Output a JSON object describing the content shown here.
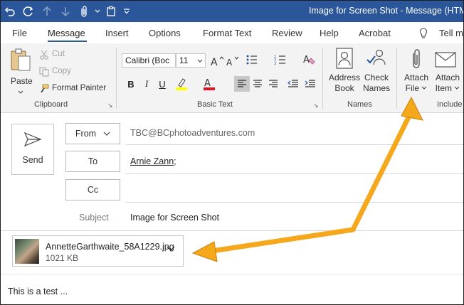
{
  "window": {
    "title": "Image for Screen Shot - Message (HTML)"
  },
  "tabs": [
    {
      "label": "File"
    },
    {
      "label": "Message"
    },
    {
      "label": "Insert"
    },
    {
      "label": "Options"
    },
    {
      "label": "Format Text"
    },
    {
      "label": "Review"
    },
    {
      "label": "Help"
    },
    {
      "label": "Acrobat"
    },
    {
      "label": "Tell m"
    }
  ],
  "ribbon": {
    "clipboard": {
      "paste": "Paste",
      "cut": "Cut",
      "copy": "Copy",
      "format_painter": "Format Painter",
      "label": "Clipboard"
    },
    "basic_text": {
      "font_name": "Calibri (Boc",
      "font_size": "11",
      "label": "Basic Text"
    },
    "names": {
      "address_book_1": "Address",
      "address_book_2": "Book",
      "check_names_1": "Check",
      "check_names_2": "Names",
      "label": "Names"
    },
    "include": {
      "attach_file_1": "Attach",
      "attach_file_2": "File",
      "attach_item_1": "Attach",
      "attach_item_2": "Item",
      "label": "Include"
    }
  },
  "message": {
    "send": "Send",
    "from_label": "From",
    "from_value": "TBC@BCphotoadventures.com",
    "to_label": "To",
    "to_value": "Arnie Zann;",
    "cc_label": "Cc",
    "subject_label": "Subject",
    "subject_value": "Image for Screen Shot",
    "attachment": {
      "name": "AnnetteGarthwaite_58A1229.jpg",
      "size": "1021 KB"
    },
    "body": "This is a test ..."
  },
  "colors": {
    "titlebar": "#2b579a",
    "arrow": "#f5a81c",
    "accent": "#2b579a"
  }
}
